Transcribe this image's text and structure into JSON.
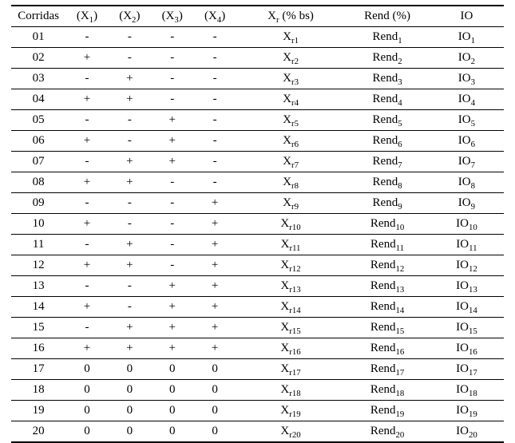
{
  "chart_data": {
    "type": "table",
    "title": "",
    "columns": [
      "Corridas",
      "(X1)",
      "(X2)",
      "(X3)",
      "(X4)",
      "Xr (% bs)",
      "Rend (%)",
      "IO"
    ],
    "rows": [
      [
        "01",
        "-",
        "-",
        "-",
        "-",
        "Xr1",
        "Rend1",
        "IO1"
      ],
      [
        "02",
        "+",
        "-",
        "-",
        "-",
        "Xr2",
        "Rend2",
        "IO2"
      ],
      [
        "03",
        "-",
        "+",
        "-",
        "-",
        "Xr3",
        "Rend3",
        "IO3"
      ],
      [
        "04",
        "+",
        "+",
        "-",
        "-",
        "Xr4",
        "Rend4",
        "IO4"
      ],
      [
        "05",
        "-",
        "-",
        "+",
        "-",
        "Xr5",
        "Rend5",
        "IO5"
      ],
      [
        "06",
        "+",
        "-",
        "+",
        "-",
        "Xr6",
        "Rend6",
        "IO6"
      ],
      [
        "07",
        "-",
        "+",
        "+",
        "-",
        "Xr7",
        "Rend7",
        "IO7"
      ],
      [
        "08",
        "+",
        "+",
        "-",
        "-",
        "Xr8",
        "Rend8",
        "IO8"
      ],
      [
        "09",
        "-",
        "-",
        "-",
        "+",
        "Xr9",
        "Rend9",
        "IO9"
      ],
      [
        "10",
        "+",
        "-",
        "-",
        "+",
        "Xr10",
        "Rend10",
        "IO10"
      ],
      [
        "11",
        "-",
        "+",
        "-",
        "+",
        "Xr11",
        "Rend11",
        "IO11"
      ],
      [
        "12",
        "+",
        "+",
        "-",
        "+",
        "Xr12",
        "Rend12",
        "IO12"
      ],
      [
        "13",
        "-",
        "-",
        "+",
        "+",
        "Xr13",
        "Rend13",
        "IO13"
      ],
      [
        "14",
        "+",
        "-",
        "+",
        "+",
        "Xr14",
        "Rend14",
        "IO14"
      ],
      [
        "15",
        "-",
        "+",
        "+",
        "+",
        "Xr15",
        "Rend15",
        "IO15"
      ],
      [
        "16",
        "+",
        "+",
        "+",
        "+",
        "Xr16",
        "Rend16",
        "IO16"
      ],
      [
        "17",
        "0",
        "0",
        "0",
        "0",
        "Xr17",
        "Rend17",
        "IO17"
      ],
      [
        "18",
        "0",
        "0",
        "0",
        "0",
        "Xr18",
        "Rend18",
        "IO18"
      ],
      [
        "19",
        "0",
        "0",
        "0",
        "0",
        "Xr19",
        "Rend19",
        "IO19"
      ],
      [
        "20",
        "0",
        "0",
        "0",
        "0",
        "Xr20",
        "Rend20",
        "IO20"
      ]
    ]
  }
}
